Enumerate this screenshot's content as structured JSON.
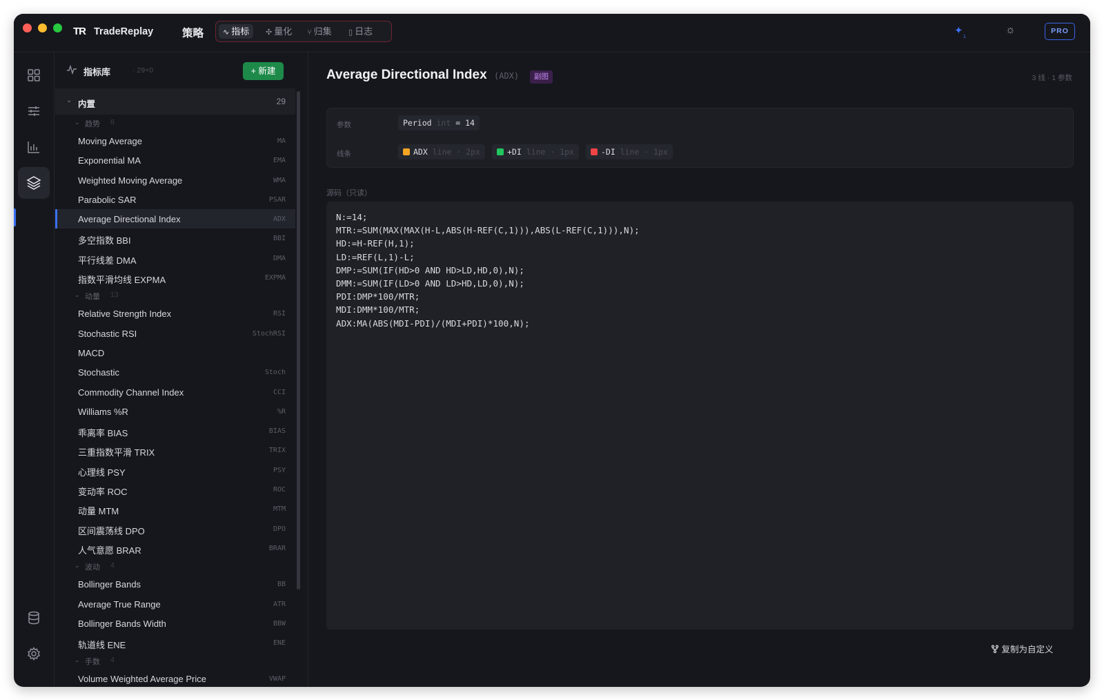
{
  "titlebar": {
    "logo": "TR",
    "app_name": "TradeReplay",
    "strategy_label": "策略",
    "tabs": [
      {
        "label": "指标",
        "icon": "pulse-icon",
        "active": true
      },
      {
        "label": "量化",
        "icon": "sparkle-icon",
        "active": false
      },
      {
        "label": "归集",
        "icon": "branch-icon",
        "active": false
      },
      {
        "label": "日志",
        "icon": "book-icon",
        "active": false
      }
    ],
    "ai_badge_count": "1",
    "pro_label": "PRO"
  },
  "sidebar": {
    "title": "指标库",
    "count": "· 29+0",
    "new_button": "新建",
    "builtin_group": {
      "label": "内置",
      "count": "29"
    },
    "categories": [
      {
        "label": "趋势",
        "count": "8",
        "items": [
          {
            "name": "Moving Average",
            "abbr": "MA"
          },
          {
            "name": "Exponential MA",
            "abbr": "EMA"
          },
          {
            "name": "Weighted Moving Average",
            "abbr": "WMA"
          },
          {
            "name": "Parabolic SAR",
            "abbr": "PSAR"
          },
          {
            "name": "Average Directional Index",
            "abbr": "ADX",
            "active": true
          },
          {
            "name": "多空指数 BBI",
            "abbr": "BBI"
          },
          {
            "name": "平行线差 DMA",
            "abbr": "DMA"
          },
          {
            "name": "指数平滑均线 EXPMA",
            "abbr": "EXPMA"
          }
        ]
      },
      {
        "label": "动量",
        "count": "13",
        "items": [
          {
            "name": "Relative Strength Index",
            "abbr": "RSI"
          },
          {
            "name": "Stochastic RSI",
            "abbr": "StochRSI"
          },
          {
            "name": "MACD",
            "abbr": ""
          },
          {
            "name": "Stochastic",
            "abbr": "Stoch"
          },
          {
            "name": "Commodity Channel Index",
            "abbr": "CCI"
          },
          {
            "name": "Williams %R",
            "abbr": "%R"
          },
          {
            "name": "乖离率 BIAS",
            "abbr": "BIAS"
          },
          {
            "name": "三重指数平滑 TRIX",
            "abbr": "TRIX"
          },
          {
            "name": "心理线 PSY",
            "abbr": "PSY"
          },
          {
            "name": "变动率 ROC",
            "abbr": "ROC"
          },
          {
            "name": "动量 MTM",
            "abbr": "MTM"
          },
          {
            "name": "区间震荡线 DPO",
            "abbr": "DPO"
          },
          {
            "name": "人气意愿 BRAR",
            "abbr": "BRAR"
          }
        ]
      },
      {
        "label": "波动",
        "count": "4",
        "items": [
          {
            "name": "Bollinger Bands",
            "abbr": "BB"
          },
          {
            "name": "Average True Range",
            "abbr": "ATR"
          },
          {
            "name": "Bollinger Bands Width",
            "abbr": "BBW"
          },
          {
            "name": "轨道线 ENE",
            "abbr": "ENE"
          }
        ]
      },
      {
        "label": "手数",
        "count": "4",
        "items": [
          {
            "name": "Volume Weighted Average Price",
            "abbr": "VWAP"
          }
        ]
      }
    ]
  },
  "main": {
    "title": "Average Directional Index",
    "abbr": "(ADX)",
    "badge": "副图",
    "meta": "3 线 · 1 参数",
    "params_label": "参数",
    "param": {
      "name": "Period",
      "type": "int",
      "eq": "=",
      "value": "14"
    },
    "lines_label": "线条",
    "lines": [
      {
        "name": "ADX",
        "style": "line · 2px",
        "color": "#f5a524"
      },
      {
        "name": "+DI",
        "style": "line · 1px",
        "color": "#22c55e"
      },
      {
        "name": "-DI",
        "style": "line · 1px",
        "color": "#ef4444"
      }
    ],
    "source_label": "源码（只读）",
    "code_lines": [
      "N:=14;",
      "MTR:=SUM(MAX(MAX(H-L,ABS(H-REF(C,1))),ABS(L-REF(C,1))),N);",
      "HD:=H-REF(H,1);",
      "LD:=REF(L,1)-L;",
      "DMP:=SUM(IF(HD>0 AND HD>LD,HD,0),N);",
      "DMM:=SUM(IF(LD>0 AND LD>HD,LD,0),N);",
      "PDI:DMP*100/MTR;",
      "MDI:DMM*100/MTR;",
      "ADX:MA(ABS(MDI-PDI)/(MDI+PDI)*100,N);"
    ],
    "copy_button": "复制为自定义"
  }
}
